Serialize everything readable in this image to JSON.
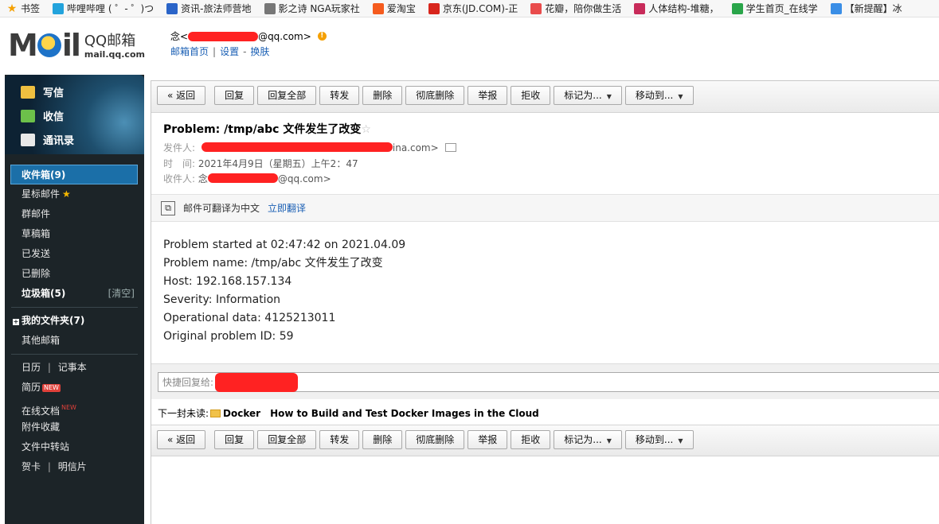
{
  "bookmarks": [
    {
      "label": "书签",
      "icon": "star-icon",
      "color": "#f5a000"
    },
    {
      "label": "哔哩哔哩 ( ゜- ゜)つ",
      "icon": "bilibili-icon",
      "color": "#23a3dc"
    },
    {
      "label": "资讯-旅法师营地",
      "icon": "yingdi-icon",
      "color": "#2a64c8"
    },
    {
      "label": "影之诗 NGA玩家社",
      "icon": "globe-icon",
      "color": "#777777"
    },
    {
      "label": "爱淘宝",
      "icon": "taobao-icon",
      "color": "#f55b1e"
    },
    {
      "label": "京东(JD.COM)-正",
      "icon": "jd-icon",
      "color": "#d8251c"
    },
    {
      "label": "花瓣，陪你做生活",
      "icon": "huaban-icon",
      "color": "#e94c4c"
    },
    {
      "label": "人体结构-堆糖，",
      "icon": "duitang-icon",
      "color": "#c82b5a"
    },
    {
      "label": "学生首页_在线学",
      "icon": "wave-icon",
      "color": "#2aa54a"
    },
    {
      "label": "【新提醒】冰",
      "icon": "bird-icon",
      "color": "#3a8ee6"
    }
  ],
  "header": {
    "logo_mail": "MOil",
    "logo_qq": "QQ邮箱",
    "logo_url": "mail.qq.com",
    "user_prefix": "念<",
    "user_suffix": "@qq.com>",
    "links": [
      "邮箱首页",
      "设置",
      "换肤"
    ]
  },
  "sidebar": {
    "buttons": [
      "写信",
      "收信",
      "通讯录"
    ],
    "folders": {
      "inbox": "收件箱(9)",
      "starred": "星标邮件",
      "group": "群邮件",
      "drafts": "草稿箱",
      "sent": "已发送",
      "deleted": "已删除",
      "spam": "垃圾箱(5)",
      "spam_clear": "[清空]",
      "my_folders": "我的文件夹(7)",
      "other": "其他邮箱",
      "calendar": "日历",
      "notes": "记事本",
      "resume": "简历",
      "new_badge": "NEW",
      "online_doc": "在线文档",
      "new_sup": "NEW",
      "attachments": "附件收藏",
      "transfer": "文件中转站",
      "greeting": "贺卡",
      "postcard": "明信片",
      "sep": "|"
    }
  },
  "toolbar": {
    "back": "« 返回",
    "reply": "回复",
    "reply_all": "回复全部",
    "forward": "转发",
    "delete": "删除",
    "delete_perm": "彻底删除",
    "report": "举报",
    "reject": "拒收",
    "mark_as": "标记为...",
    "move_to": "移动到..."
  },
  "mail": {
    "subject": "Problem: /tmp/abc 文件发生了改变",
    "from_label": "发件人:",
    "from_value": "ina.com>",
    "time_label": "时　间:",
    "time_value": "2021年4月9日（星期五）上午2：47",
    "to_label": "收件人:",
    "to_prefix": "念",
    "to_value": "@qq.com>",
    "translate_text": "邮件可翻译为中文",
    "translate_link": "立即翻译",
    "body": [
      "Problem started at 02:47:42 on 2021.04.09",
      "Problem name: /tmp/abc 文件发生了改变",
      "Host: 192.168.157.134",
      "Severity: Information",
      "Operational data: 4125213011",
      "Original problem ID: 59"
    ],
    "quick_reply_placeholder": "快捷回复给:",
    "next_label": "下一封未读:",
    "next_sender": "Docker",
    "next_title": "How to Build and Test Docker Images in the Cloud"
  },
  "colors": {
    "sidebar_bg": "#1c2428",
    "active_folder": "#1b6fa8",
    "link": "#1a5fb4",
    "redaction": "#ff2222"
  }
}
